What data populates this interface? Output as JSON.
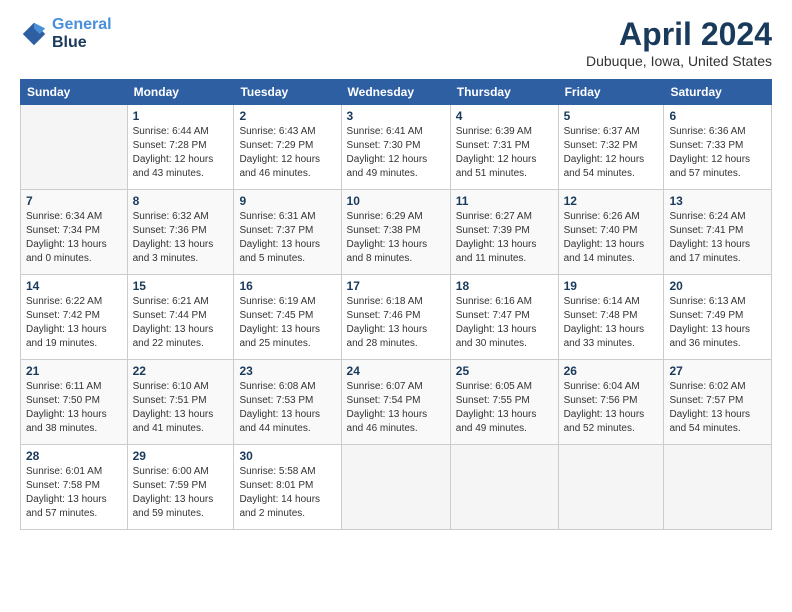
{
  "header": {
    "logo_line1": "General",
    "logo_line2": "Blue",
    "month_title": "April 2024",
    "location": "Dubuque, Iowa, United States"
  },
  "days_of_week": [
    "Sunday",
    "Monday",
    "Tuesday",
    "Wednesday",
    "Thursday",
    "Friday",
    "Saturday"
  ],
  "weeks": [
    [
      {
        "num": "",
        "info": ""
      },
      {
        "num": "1",
        "info": "Sunrise: 6:44 AM\nSunset: 7:28 PM\nDaylight: 12 hours\nand 43 minutes."
      },
      {
        "num": "2",
        "info": "Sunrise: 6:43 AM\nSunset: 7:29 PM\nDaylight: 12 hours\nand 46 minutes."
      },
      {
        "num": "3",
        "info": "Sunrise: 6:41 AM\nSunset: 7:30 PM\nDaylight: 12 hours\nand 49 minutes."
      },
      {
        "num": "4",
        "info": "Sunrise: 6:39 AM\nSunset: 7:31 PM\nDaylight: 12 hours\nand 51 minutes."
      },
      {
        "num": "5",
        "info": "Sunrise: 6:37 AM\nSunset: 7:32 PM\nDaylight: 12 hours\nand 54 minutes."
      },
      {
        "num": "6",
        "info": "Sunrise: 6:36 AM\nSunset: 7:33 PM\nDaylight: 12 hours\nand 57 minutes."
      }
    ],
    [
      {
        "num": "7",
        "info": "Sunrise: 6:34 AM\nSunset: 7:34 PM\nDaylight: 13 hours\nand 0 minutes."
      },
      {
        "num": "8",
        "info": "Sunrise: 6:32 AM\nSunset: 7:36 PM\nDaylight: 13 hours\nand 3 minutes."
      },
      {
        "num": "9",
        "info": "Sunrise: 6:31 AM\nSunset: 7:37 PM\nDaylight: 13 hours\nand 5 minutes."
      },
      {
        "num": "10",
        "info": "Sunrise: 6:29 AM\nSunset: 7:38 PM\nDaylight: 13 hours\nand 8 minutes."
      },
      {
        "num": "11",
        "info": "Sunrise: 6:27 AM\nSunset: 7:39 PM\nDaylight: 13 hours\nand 11 minutes."
      },
      {
        "num": "12",
        "info": "Sunrise: 6:26 AM\nSunset: 7:40 PM\nDaylight: 13 hours\nand 14 minutes."
      },
      {
        "num": "13",
        "info": "Sunrise: 6:24 AM\nSunset: 7:41 PM\nDaylight: 13 hours\nand 17 minutes."
      }
    ],
    [
      {
        "num": "14",
        "info": "Sunrise: 6:22 AM\nSunset: 7:42 PM\nDaylight: 13 hours\nand 19 minutes."
      },
      {
        "num": "15",
        "info": "Sunrise: 6:21 AM\nSunset: 7:44 PM\nDaylight: 13 hours\nand 22 minutes."
      },
      {
        "num": "16",
        "info": "Sunrise: 6:19 AM\nSunset: 7:45 PM\nDaylight: 13 hours\nand 25 minutes."
      },
      {
        "num": "17",
        "info": "Sunrise: 6:18 AM\nSunset: 7:46 PM\nDaylight: 13 hours\nand 28 minutes."
      },
      {
        "num": "18",
        "info": "Sunrise: 6:16 AM\nSunset: 7:47 PM\nDaylight: 13 hours\nand 30 minutes."
      },
      {
        "num": "19",
        "info": "Sunrise: 6:14 AM\nSunset: 7:48 PM\nDaylight: 13 hours\nand 33 minutes."
      },
      {
        "num": "20",
        "info": "Sunrise: 6:13 AM\nSunset: 7:49 PM\nDaylight: 13 hours\nand 36 minutes."
      }
    ],
    [
      {
        "num": "21",
        "info": "Sunrise: 6:11 AM\nSunset: 7:50 PM\nDaylight: 13 hours\nand 38 minutes."
      },
      {
        "num": "22",
        "info": "Sunrise: 6:10 AM\nSunset: 7:51 PM\nDaylight: 13 hours\nand 41 minutes."
      },
      {
        "num": "23",
        "info": "Sunrise: 6:08 AM\nSunset: 7:53 PM\nDaylight: 13 hours\nand 44 minutes."
      },
      {
        "num": "24",
        "info": "Sunrise: 6:07 AM\nSunset: 7:54 PM\nDaylight: 13 hours\nand 46 minutes."
      },
      {
        "num": "25",
        "info": "Sunrise: 6:05 AM\nSunset: 7:55 PM\nDaylight: 13 hours\nand 49 minutes."
      },
      {
        "num": "26",
        "info": "Sunrise: 6:04 AM\nSunset: 7:56 PM\nDaylight: 13 hours\nand 52 minutes."
      },
      {
        "num": "27",
        "info": "Sunrise: 6:02 AM\nSunset: 7:57 PM\nDaylight: 13 hours\nand 54 minutes."
      }
    ],
    [
      {
        "num": "28",
        "info": "Sunrise: 6:01 AM\nSunset: 7:58 PM\nDaylight: 13 hours\nand 57 minutes."
      },
      {
        "num": "29",
        "info": "Sunrise: 6:00 AM\nSunset: 7:59 PM\nDaylight: 13 hours\nand 59 minutes."
      },
      {
        "num": "30",
        "info": "Sunrise: 5:58 AM\nSunset: 8:01 PM\nDaylight: 14 hours\nand 2 minutes."
      },
      {
        "num": "",
        "info": ""
      },
      {
        "num": "",
        "info": ""
      },
      {
        "num": "",
        "info": ""
      },
      {
        "num": "",
        "info": ""
      }
    ]
  ]
}
